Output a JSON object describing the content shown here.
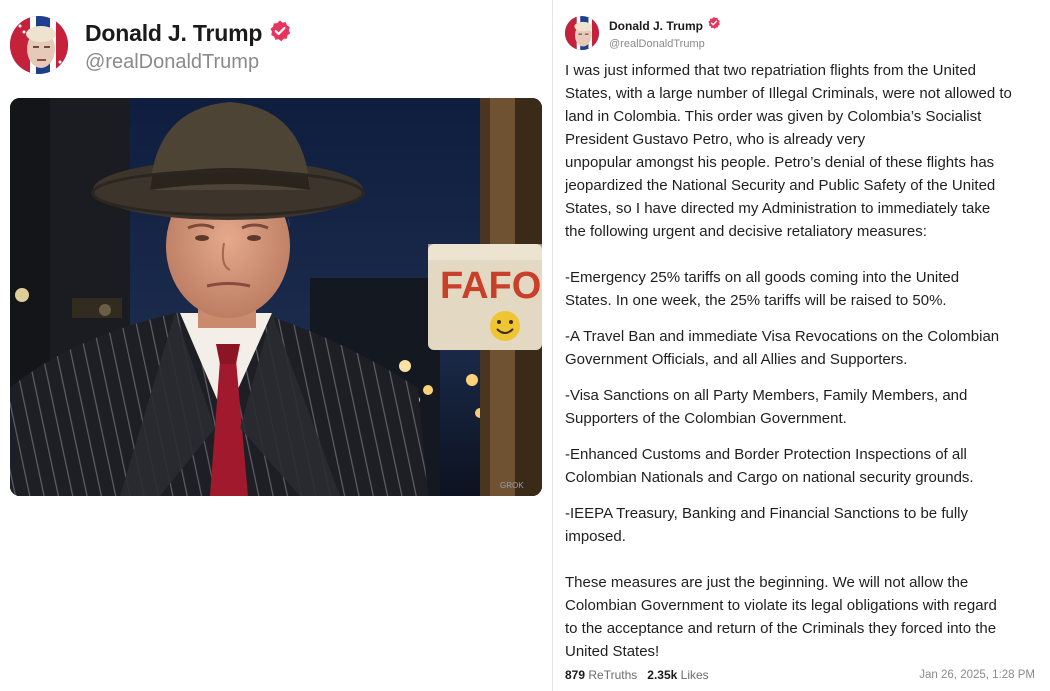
{
  "left_post": {
    "author_name": "Donald J. Trump",
    "author_handle": "@realDonaldTrump",
    "image": {
      "sign_text": "FAFO",
      "watermark": "GROK"
    }
  },
  "right_post": {
    "author_name": "Donald J. Trump",
    "author_handle": "@realDonaldTrump",
    "intro_lines": [
      "I was just informed that two repatriation flights from the United",
      "States, with a large number of Illegal Criminals, were not allowed to",
      "land in Colombia. This order was given by Colombia’s Socialist",
      "President Gustavo Petro, who is already very",
      "unpopular amongst his people. Petro’s denial of these flights has",
      "jeopardized the National Security and Public Safety of the United",
      "States, so I have directed my Administration to immediately take",
      "the following urgent and decisive retaliatory measures:"
    ],
    "measures": [
      [
        "-Emergency 25% tariffs on all goods coming into the United",
        "States. In one week, the 25% tariffs will be raised to 50%."
      ],
      [
        "-A Travel Ban and immediate Visa Revocations on the Colombian",
        "Government Officials, and all Allies and Supporters."
      ],
      [
        "-Visa Sanctions on all Party Members, Family Members, and",
        "Supporters of the Colombian Government."
      ],
      [
        "-Enhanced Customs and Border Protection Inspections of all",
        "Colombian Nationals and Cargo on national security grounds."
      ],
      [
        "-IEEPA Treasury, Banking and Financial Sanctions to be fully",
        "imposed."
      ]
    ],
    "closing_lines": [
      "These measures are just the beginning. We will not allow the",
      "Colombian Government to violate its legal obligations with regard",
      "to the acceptance and return of the Criminals they forced into the",
      "United States!"
    ],
    "footer": {
      "retruths_count": "879",
      "retruths_label": "ReTruths",
      "likes_count": "2.35k",
      "likes_label": "Likes",
      "date": "Jan 26, 2025, 1:28 PM"
    }
  },
  "colors": {
    "verified_badge": "#e8335d",
    "handle_gray": "#8a8a8a",
    "sign_red": "#c8402a",
    "tie_red": "#a0192c"
  },
  "icons": [
    "verified-badge-icon",
    "avatar-flag-portrait",
    "smiley-face-icon",
    "grok-watermark"
  ]
}
